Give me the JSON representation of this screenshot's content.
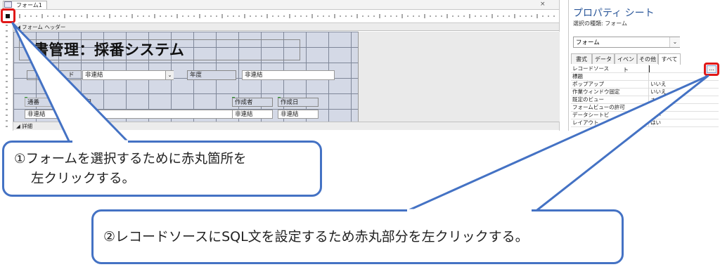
{
  "designer": {
    "tab_title": "フォーム1",
    "close_glyph": "×",
    "form_header_label": "フォーム ヘッダー",
    "detail_label": "詳細",
    "title_text": "書管理：採番システム",
    "controls": {
      "combo_label": "ド",
      "combo_value": "非連結",
      "year_label": "年度",
      "year_value": "非連結",
      "num_label": "通番",
      "num_extra_label": "目",
      "num_value": "非連結",
      "author_label": "作成者",
      "author_value": "非連結",
      "date_label": "作成日",
      "date_value": "非連結"
    }
  },
  "properties": {
    "title": "プロパティ シート",
    "selection_type": "選択の種類: フォーム",
    "object_combo": "フォーム",
    "tabs": [
      "書式",
      "データ",
      "イベント",
      "その他",
      "すべて"
    ],
    "active_tab": "すべて",
    "rows": [
      {
        "name": "レコードソース",
        "value": ""
      },
      {
        "name": "標題",
        "value": ""
      },
      {
        "name": "ポップアップ",
        "value": "いいえ"
      },
      {
        "name": "作業ウィンドウ固定",
        "value": "いいえ"
      },
      {
        "name": "既定のビュー",
        "value": "ォーム"
      },
      {
        "name": "フォームビューの許可",
        "value": ""
      },
      {
        "name": "データシートビ",
        "value": "はい"
      },
      {
        "name": "レイアウト",
        "value": "はい"
      }
    ],
    "builder_glyph": "…"
  },
  "callouts": {
    "one": "①フォームを選択するために赤丸箇所を左クリックする。",
    "two": "②レコードソースにSQL文を設定するため赤丸部分を左クリックする。"
  },
  "colors": {
    "callout_border": "#4472c4",
    "highlight_ring": "#e01818",
    "grid_fill": "#d4d9e6"
  }
}
